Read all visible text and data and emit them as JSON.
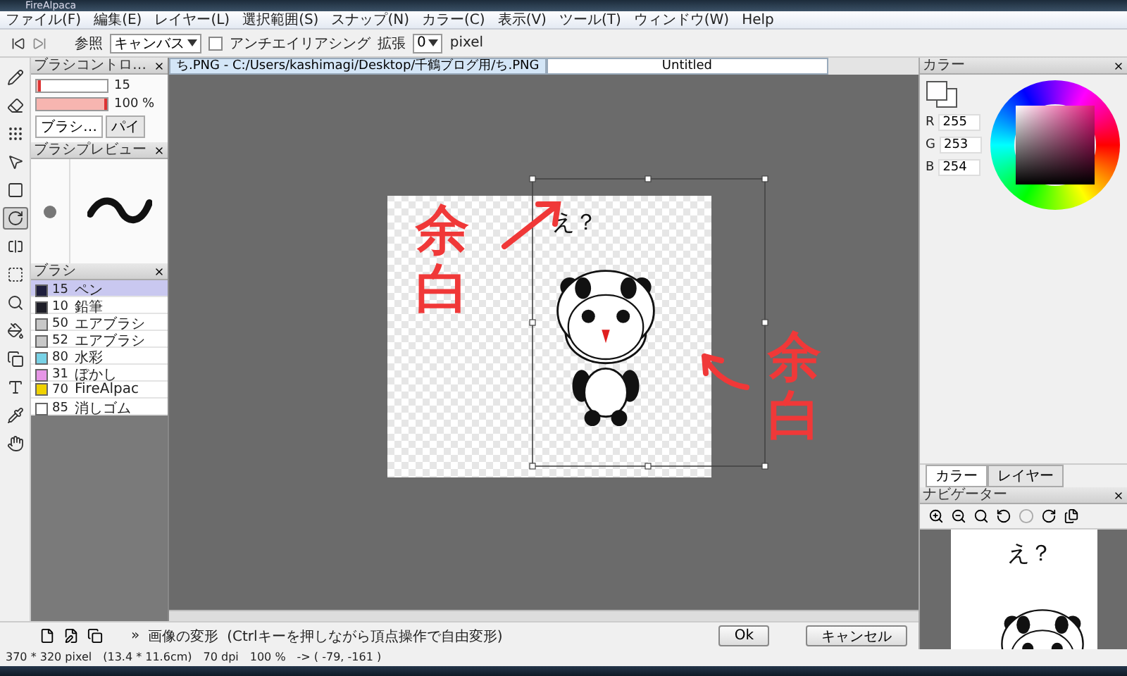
{
  "window": {
    "title": "FireAlpaca"
  },
  "menu": [
    "ファイル(F)",
    "編集(E)",
    "レイヤー(L)",
    "選択範囲(S)",
    "スナップ(N)",
    "カラー(C)",
    "表示(V)",
    "ツール(T)",
    "ウィンドウ(W)",
    "Help"
  ],
  "toolbar": {
    "reference_label": "参照",
    "reference_value": "キャンバス",
    "antialias": {
      "label": "アンチエイリアシング",
      "checked": false
    },
    "expand_label": "拡張",
    "expand_value": "0",
    "unit": "pixel"
  },
  "tools": [
    {
      "kind": "pen",
      "selected": false
    },
    {
      "kind": "eraser",
      "selected": false
    },
    {
      "kind": "dots",
      "selected": false
    },
    {
      "kind": "move",
      "selected": false
    },
    {
      "kind": "fill",
      "selected": false
    },
    {
      "kind": "transform",
      "selected": true
    },
    {
      "kind": "gradient",
      "selected": false
    },
    {
      "kind": "select",
      "selected": false
    },
    {
      "kind": "zoom",
      "selected": false
    },
    {
      "kind": "bucket",
      "selected": false
    },
    {
      "kind": "bucket2",
      "selected": false
    },
    {
      "kind": "text",
      "selected": false
    },
    {
      "kind": "eyedropper",
      "selected": false
    },
    {
      "kind": "hand",
      "selected": false
    }
  ],
  "brush_control": {
    "title": "ブラシコントロ…",
    "size": {
      "level": 0.06,
      "reading": "15"
    },
    "opacity": {
      "level": 1,
      "reading": "100 %"
    },
    "tabs": [
      {
        "label": "ブラシ…",
        "selected": true
      },
      {
        "label": "パイ",
        "selected": false
      }
    ]
  },
  "brush_preview": {
    "title": "ブラシプレビュー"
  },
  "brushes": {
    "title": "ブラシ",
    "items": [
      {
        "size": "15",
        "name": "ペン",
        "color": "#1e1e3c",
        "selected": true
      },
      {
        "size": "10",
        "name": "鉛筆",
        "color": "#1e1e28",
        "selected": false
      },
      {
        "size": "50",
        "name": "エアブラシ",
        "color": "#c8c8c8",
        "selected": false
      },
      {
        "size": "52",
        "name": "エアブラシ",
        "color": "#c8c8c8",
        "selected": false
      },
      {
        "size": "80",
        "name": "水彩",
        "color": "#78d2e6",
        "selected": false
      },
      {
        "size": "31",
        "name": "ぼかし",
        "color": "#e696e6",
        "selected": false
      },
      {
        "size": "70",
        "name": "FireAlpac",
        "color": "#f0d200",
        "selected": false
      },
      {
        "size": "85",
        "name": "消しゴム",
        "color": "#ffffff",
        "selected": false
      }
    ]
  },
  "document_tabs": [
    {
      "label": "ち.PNG - C:/Users/kashimagi/Desktop/千鶴ブログ用/ち.PNG",
      "selected": true
    },
    {
      "label": "Untitled",
      "selected": false
    }
  ],
  "canvas": {
    "artwork_text": "え？",
    "annotations": [
      "余白",
      "余白"
    ]
  },
  "color_panel": {
    "title": "カラー",
    "r": {
      "label": "R",
      "value": "255"
    },
    "g": {
      "label": "G",
      "value": "253"
    },
    "b": {
      "label": "B",
      "value": "254"
    },
    "tabs": [
      {
        "label": "カラー",
        "selected": true
      },
      {
        "label": "レイヤー",
        "selected": false
      }
    ]
  },
  "navigator": {
    "title": "ナビゲーター",
    "thumbnail_text": "え？"
  },
  "transform_bar": {
    "expand": "»",
    "title": "画像の変形",
    "hint": "(Ctrlキーを押しながら頂点操作で自由変形)",
    "buttons": [
      "Ok",
      "キャンセル"
    ]
  },
  "status_bar": [
    "370 * 320 pixel",
    "(13.4 * 11.6cm)",
    "70 dpi",
    "100 %",
    "-> ( -79, -161 )"
  ]
}
